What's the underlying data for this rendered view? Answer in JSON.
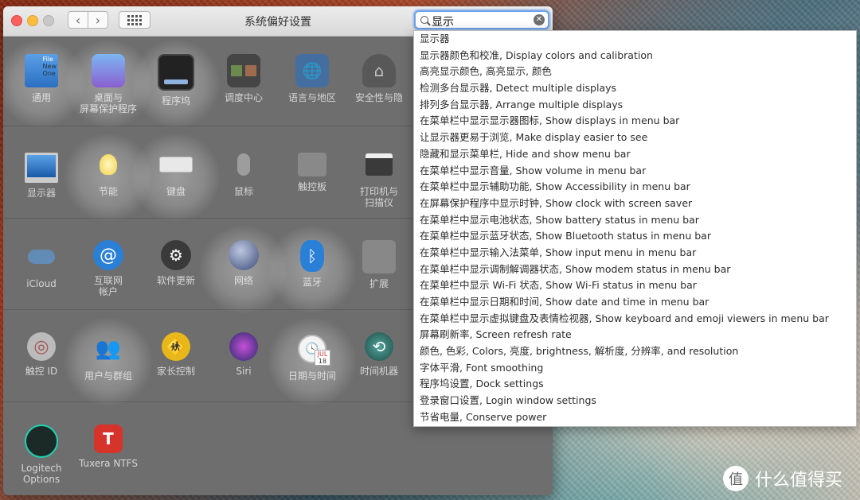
{
  "window": {
    "title": "系统偏好设置"
  },
  "search": {
    "value": "显示",
    "clear_icon": "clear-icon"
  },
  "prefs": {
    "general": "通用",
    "desktop": "桌面与\n屏幕保护程序",
    "dock": "程序坞",
    "mission": "调度中心",
    "language": "语言与地区",
    "security": "安全性与隐",
    "displays": "显示器",
    "energy": "节能",
    "keyboard": "键盘",
    "mouse": "鼠标",
    "trackpad": "触控板",
    "printers": "打印机与\n扫描仪",
    "icloud": "iCloud",
    "internet": "互联网\n帐户",
    "software": "软件更新",
    "network": "网络",
    "bluetooth": "蓝牙",
    "extensions": "扩展",
    "touchid": "触控 ID",
    "users": "用户与群组",
    "parental": "家长控制",
    "siri": "Siri",
    "datetime": "日期与时间",
    "timemachine": "时间机器",
    "logitech": "Logitech Options",
    "tuxera": "Tuxera NTFS",
    "general_badge_1": "File",
    "general_badge_2": "New",
    "general_badge_3": "One",
    "calendar_month": "JUL",
    "calendar_day": "18",
    "tuxera_letter": "T"
  },
  "results": [
    "显示器",
    "显示器颜色和校准, Display colors and calibration",
    "高亮显示颜色, 高亮显示, 颜色",
    "检测多台显示器, Detect multiple displays",
    "排列多台显示器, Arrange multiple displays",
    "在菜单栏中显示显示器图标, Show displays in menu bar",
    "让显示器更易于浏览, Make display easier to see",
    "隐藏和显示菜单栏, Hide and show menu bar",
    "在菜单栏中显示音量, Show volume in menu bar",
    "在菜单栏中显示辅助功能, Show Accessibility in menu bar",
    "在屏幕保护程序中显示时钟, Show clock with screen saver",
    "在菜单栏中显示电池状态, Show battery status in menu bar",
    "在菜单栏中显示蓝牙状态, Show Bluetooth status in menu bar",
    "在菜单栏中显示输入法菜单, Show input menu in menu bar",
    "在菜单栏中显示调制解调器状态, Show modem status in menu bar",
    "在菜单栏中显示 Wi-Fi 状态, Show Wi-Fi status in menu bar",
    "在菜单栏中显示日期和时间, Show date and time in menu bar",
    "在菜单栏中显示虚拟键盘及表情检视器, Show keyboard and emoji viewers in menu bar",
    "屏幕刷新率, Screen refresh rate",
    "颜色, 色彩, Colors, 亮度, brightness, 解析度, 分辨率, and resolution",
    "字体平滑, Font smoothing",
    "程序坞设置, Dock settings",
    "登录窗口设置, Login window settings",
    "节省电量, Conserve power"
  ],
  "watermark": {
    "text": "什么值得买",
    "logo_text": "值"
  },
  "colors": {
    "accent": "#6ea2e8",
    "window_dim": "#6e6e6e"
  }
}
